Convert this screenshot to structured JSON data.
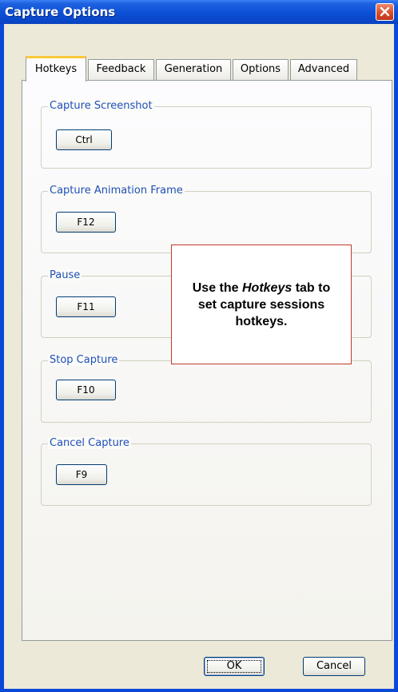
{
  "window": {
    "title": "Capture Options",
    "close_icon": "close-icon",
    "titlebar_color": "#0b4fd6",
    "close_color": "#d6492a"
  },
  "tabs": [
    {
      "label": "Hotkeys",
      "active": true
    },
    {
      "label": "Feedback",
      "active": false
    },
    {
      "label": "Generation",
      "active": false
    },
    {
      "label": "Options",
      "active": false
    },
    {
      "label": "Advanced",
      "active": false
    }
  ],
  "groups": [
    {
      "label": "Capture Screenshot",
      "key": "Ctrl"
    },
    {
      "label": "Capture Animation Frame",
      "key": "F12"
    },
    {
      "label": "Pause",
      "key": "F11"
    },
    {
      "label": "Stop Capture",
      "key": "F10"
    },
    {
      "label": "Cancel Capture",
      "key": "F9"
    }
  ],
  "callout": {
    "prefix": "Use the ",
    "emphasis": "Hotkeys",
    "suffix": " tab to set capture sessions hotkeys.",
    "border_color": "#c0392b"
  },
  "buttons": {
    "ok": "OK",
    "cancel": "Cancel"
  }
}
